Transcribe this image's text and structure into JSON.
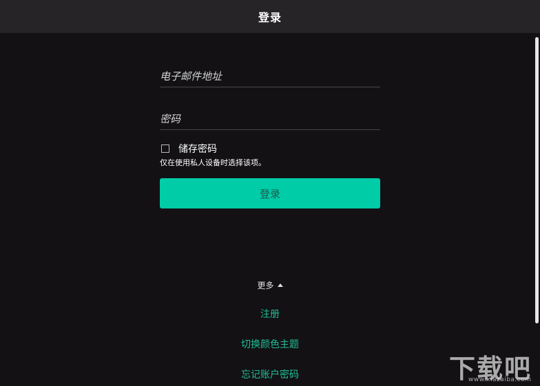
{
  "window": {
    "title": "登录"
  },
  "form": {
    "email_placeholder": "电子邮件地址",
    "password_placeholder": "密码",
    "remember_label": "储存密码",
    "remember_checked": false,
    "remember_hint": "仅在使用私人设备时选择该项。",
    "login_button": "登录"
  },
  "more": {
    "label": "更多",
    "links": [
      "注册",
      "切换颜色主题",
      "忘记账户密码"
    ]
  },
  "watermark": {
    "main": "下载吧",
    "sub": "www.xiazaiba.com"
  },
  "colors": {
    "background": "#131114",
    "titlebar": "#262427",
    "accent": "#00cca8",
    "link": "#1fbf98"
  }
}
